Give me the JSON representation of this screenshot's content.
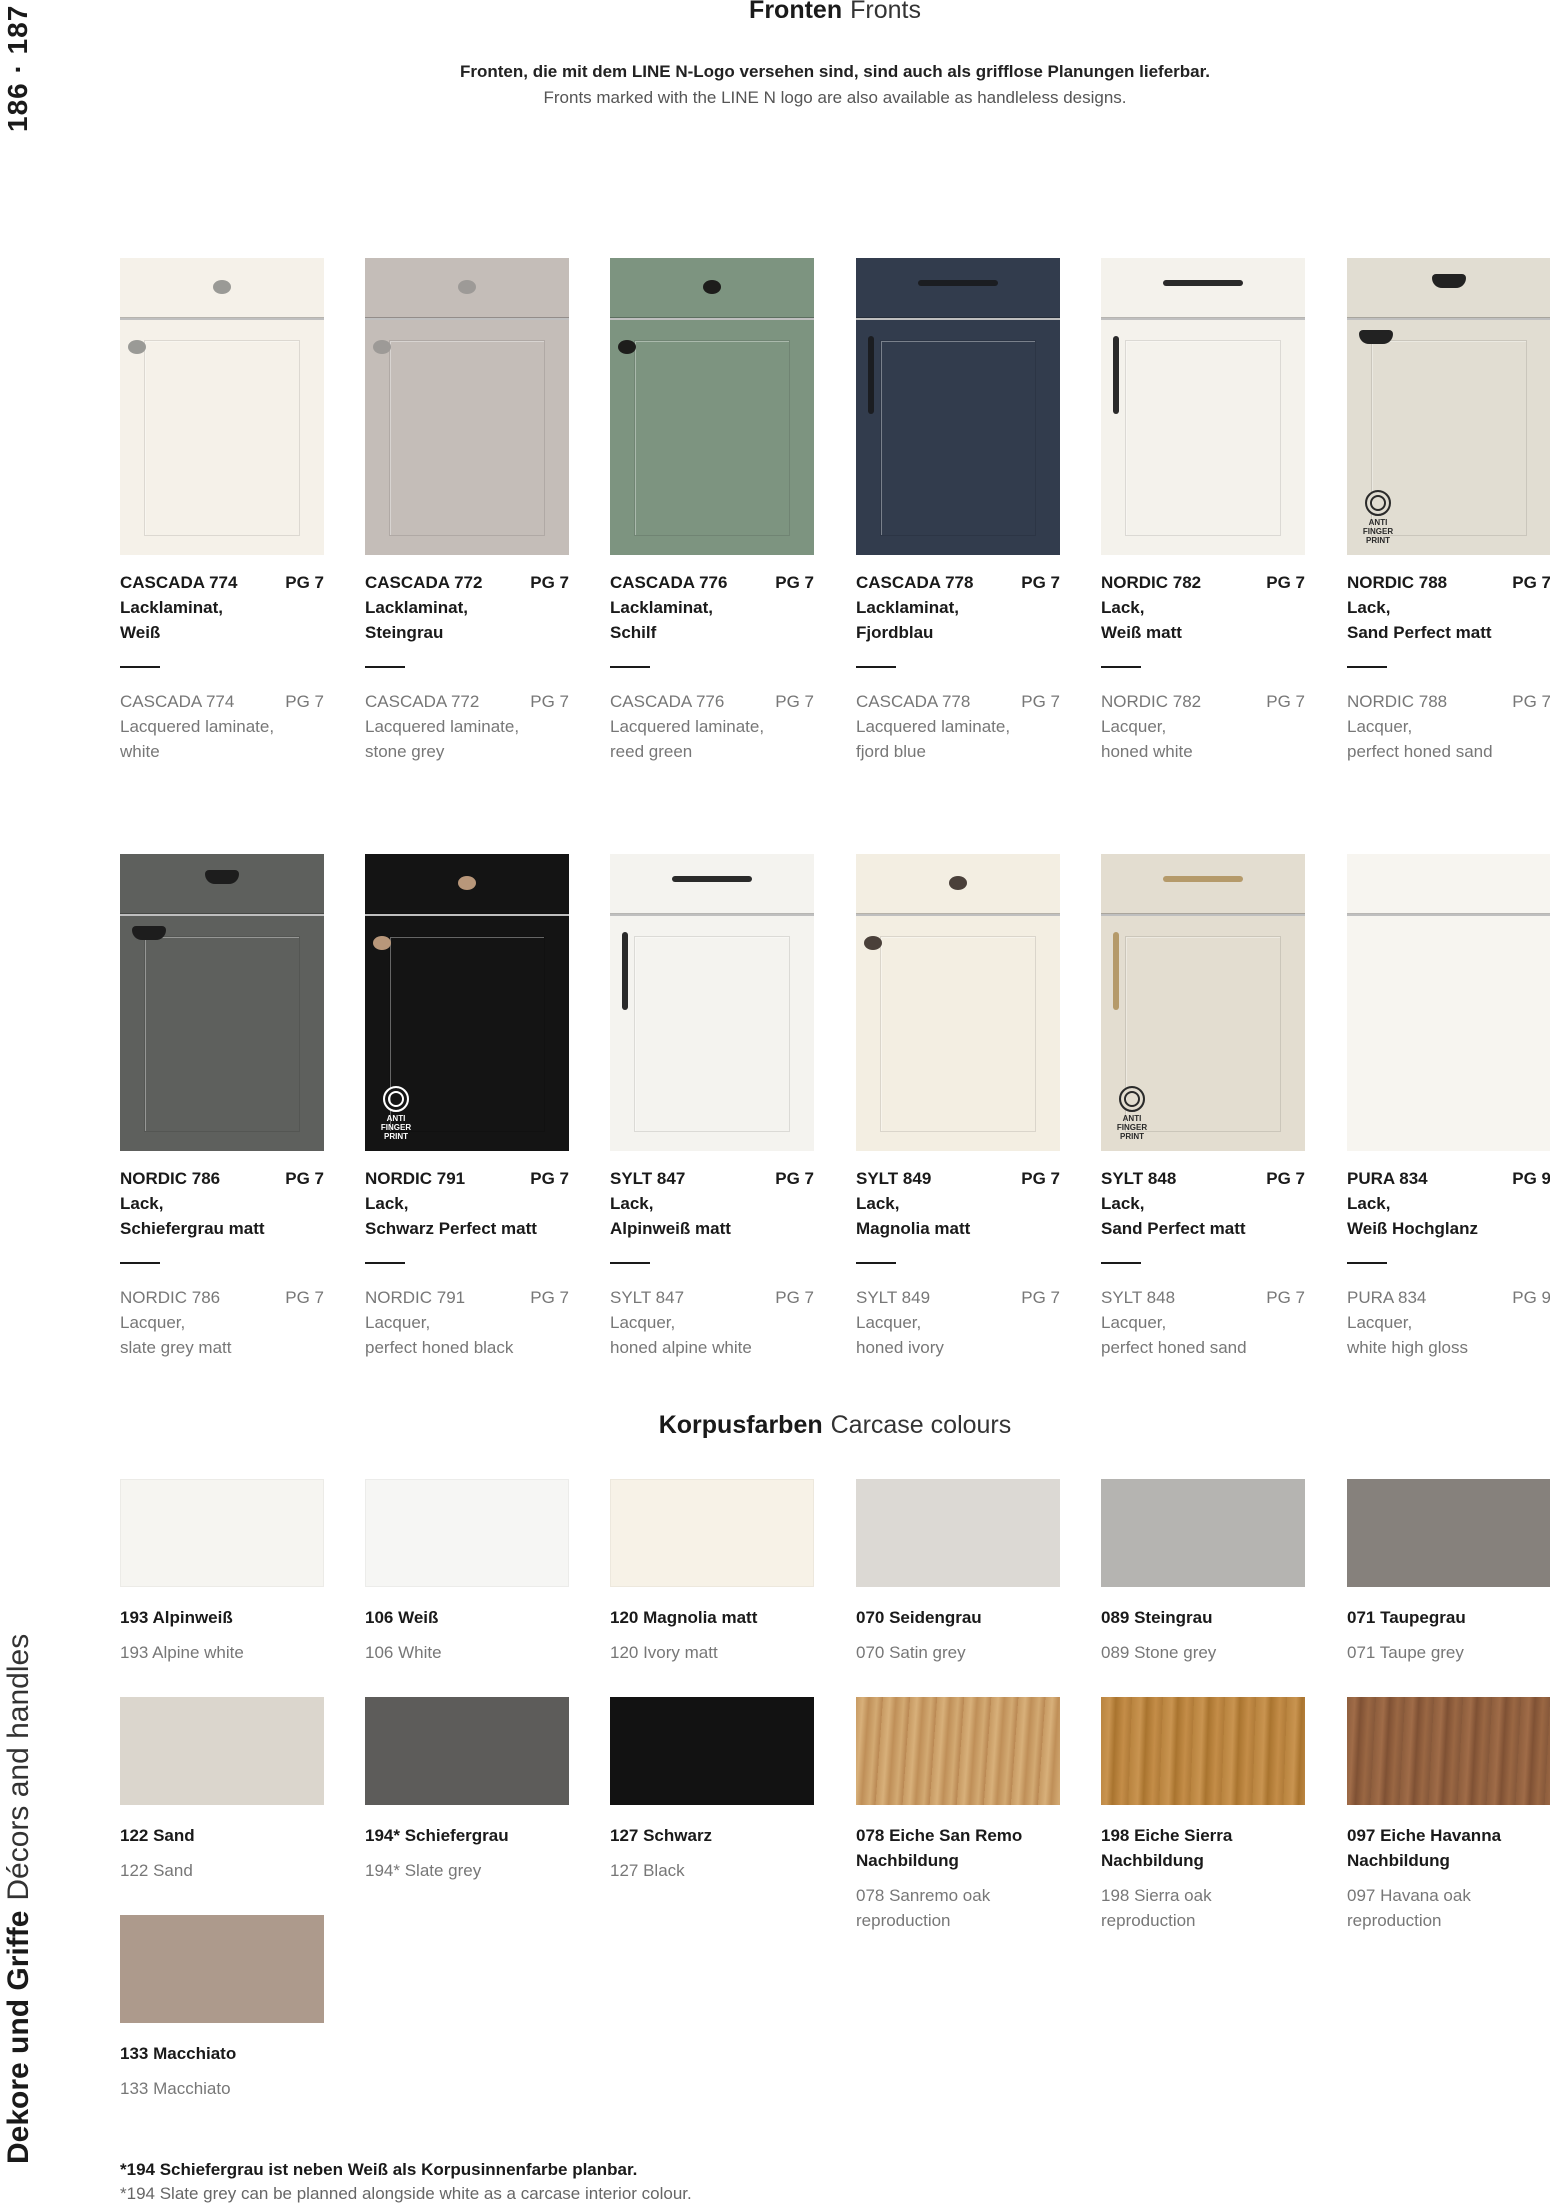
{
  "page_numbers": "186 · 187",
  "section": {
    "de": "Dekore und Griffe",
    "en": "Décors and handles"
  },
  "fronts": {
    "title_de": "Fronten",
    "title_en": "Fronts",
    "intro_de": "Fronten, die mit dem LINE N-Logo versehen sind, sind auch als grifflose Planungen lieferbar.",
    "intro_en": "Fronts marked with the LINE N logo are also available as handleless designs.",
    "anti_fingerprint_label": "ANTI FINGER PRINT",
    "items": [
      {
        "name": "CASCADA 774",
        "pg": "PG 7",
        "de1": "Lacklaminat,",
        "de2": "Weiß",
        "en1": "Lacquered laminate,",
        "en2": "white",
        "color": "#f5f1e9",
        "handle": "knob",
        "handle_color": "#9a9a96",
        "afp": false
      },
      {
        "name": "CASCADA 772",
        "pg": "PG 7",
        "de1": "Lacklaminat,",
        "de2": "Steingrau",
        "en1": "Lacquered laminate,",
        "en2": "stone grey",
        "color": "#c4bdb8",
        "handle": "knob",
        "handle_color": "#9d9a97",
        "afp": false
      },
      {
        "name": "CASCADA 776",
        "pg": "PG 7",
        "de1": "Lacklaminat,",
        "de2": "Schilf",
        "en1": "Lacquered laminate,",
        "en2": "reed green",
        "color": "#7d9480",
        "handle": "knob",
        "handle_color": "#1d1d1b",
        "afp": false
      },
      {
        "name": "CASCADA 778",
        "pg": "PG 7",
        "de1": "Lacklaminat,",
        "de2": "Fjordblau",
        "en1": "Lacquered laminate,",
        "en2": "fjord blue",
        "color": "#323c4d",
        "handle": "bar",
        "handle_color": "#1b1d21",
        "afp": false
      },
      {
        "name": "NORDIC 782",
        "pg": "PG 7",
        "de1": "Lack,",
        "de2": "Weiß matt",
        "en1": "Lacquer,",
        "en2": "honed white",
        "color": "#f4f2ec",
        "handle": "bar",
        "handle_color": "#2a2a2a",
        "afp": false
      },
      {
        "name": "NORDIC 788",
        "pg": "PG 7",
        "de1": "Lack,",
        "de2": "Sand Perfect matt",
        "en1": "Lacquer,",
        "en2": "perfect honed sand",
        "color": "#e1ddd2",
        "handle": "cup",
        "handle_color": "#222222",
        "afp": true
      },
      {
        "name": "NORDIC 786",
        "pg": "PG 7",
        "de1": "Lack,",
        "de2": "Schiefergrau matt",
        "en1": "Lacquer,",
        "en2": "slate grey matt",
        "color": "#5e605d",
        "handle": "cup",
        "handle_color": "#1d1d1d",
        "afp": false
      },
      {
        "name": "NORDIC 791",
        "pg": "PG 7",
        "de1": "Lack,",
        "de2": "Schwarz Perfect matt",
        "en1": "Lacquer,",
        "en2": "perfect honed black",
        "color": "#141414",
        "handle": "knob",
        "handle_color": "#b8977a",
        "afp": true
      },
      {
        "name": "SYLT 847",
        "pg": "PG 7",
        "de1": "Lack,",
        "de2": "Alpinweiß matt",
        "en1": "Lacquer,",
        "en2": "honed alpine white",
        "color": "#f4f3ef",
        "handle": "bar",
        "handle_color": "#2a2a2a",
        "afp": false
      },
      {
        "name": "SYLT 849",
        "pg": "PG 7",
        "de1": "Lack,",
        "de2": "Magnolia matt",
        "en1": "Lacquer,",
        "en2": "honed ivory",
        "color": "#f3eee2",
        "handle": "knob",
        "handle_color": "#4a403a",
        "afp": false
      },
      {
        "name": "SYLT 848",
        "pg": "PG 7",
        "de1": "Lack,",
        "de2": "Sand Perfect matt",
        "en1": "Lacquer,",
        "en2": "perfect honed sand",
        "color": "#e3ddd0",
        "handle": "bar",
        "handle_color": "#b59a6a",
        "afp": true
      },
      {
        "name": "PURA 834",
        "pg": "PG 9",
        "de1": "Lack,",
        "de2": "Weiß Hochglanz",
        "en1": "Lacquer,",
        "en2": "white high gloss",
        "color": "#f7f5f0",
        "handle": "none",
        "handle_color": "#ffffff",
        "afp": false
      }
    ]
  },
  "carcase": {
    "title_de": "Korpusfarben",
    "title_en": "Carcase colours",
    "items": [
      {
        "de": "193 Alpinweiß",
        "en": "193 Alpine white",
        "color": "#f6f5f1",
        "wood": ""
      },
      {
        "de": "106 Weiß",
        "en": "106 White",
        "color": "#f6f6f4",
        "wood": ""
      },
      {
        "de": "120 Magnolia matt",
        "en": "120 Ivory matt",
        "color": "#f7f2e7",
        "wood": ""
      },
      {
        "de": "070 Seidengrau",
        "en": "070 Satin grey",
        "color": "#dcd9d4",
        "wood": ""
      },
      {
        "de": "089 Steingrau",
        "en": "089 Stone grey",
        "color": "#b5b4b1",
        "wood": ""
      },
      {
        "de": "071 Taupegrau",
        "en": "071 Taupe grey",
        "color": "#86817c",
        "wood": ""
      },
      {
        "de": "122 Sand",
        "en": "122 Sand",
        "color": "#dbd6cd",
        "wood": ""
      },
      {
        "de": "194* Schiefergrau",
        "en": "194* Slate grey",
        "color": "#5d5c5a",
        "wood": ""
      },
      {
        "de": "127 Schwarz",
        "en": "127 Black",
        "color": "#121212",
        "wood": ""
      },
      {
        "de": "078 Eiche San Remo",
        "de2": "Nachbildung",
        "en": "078 Sanremo oak",
        "en2": "reproduction",
        "color": "#c9a06a",
        "wood": "wood-sanremo"
      },
      {
        "de": "198 Eiche Sierra",
        "de2": "Nachbildung",
        "en": "198 Sierra oak",
        "en2": "reproduction",
        "color": "#b98544",
        "wood": "wood-sierra"
      },
      {
        "de": "097 Eiche Havanna",
        "de2": "Nachbildung",
        "en": "097 Havana oak",
        "en2": "reproduction",
        "color": "#8d5e3e",
        "wood": "wood-havanna"
      },
      {
        "de": "133 Macchiato",
        "en": "133 Macchiato",
        "color": "#ad9a8c",
        "wood": ""
      }
    ]
  },
  "footnote": {
    "de": "*194 Schiefergrau ist neben Weiß als Korpusinnenfarbe planbar.",
    "en": "*194 Slate grey can be planned alongside white as a carcase interior colour."
  }
}
